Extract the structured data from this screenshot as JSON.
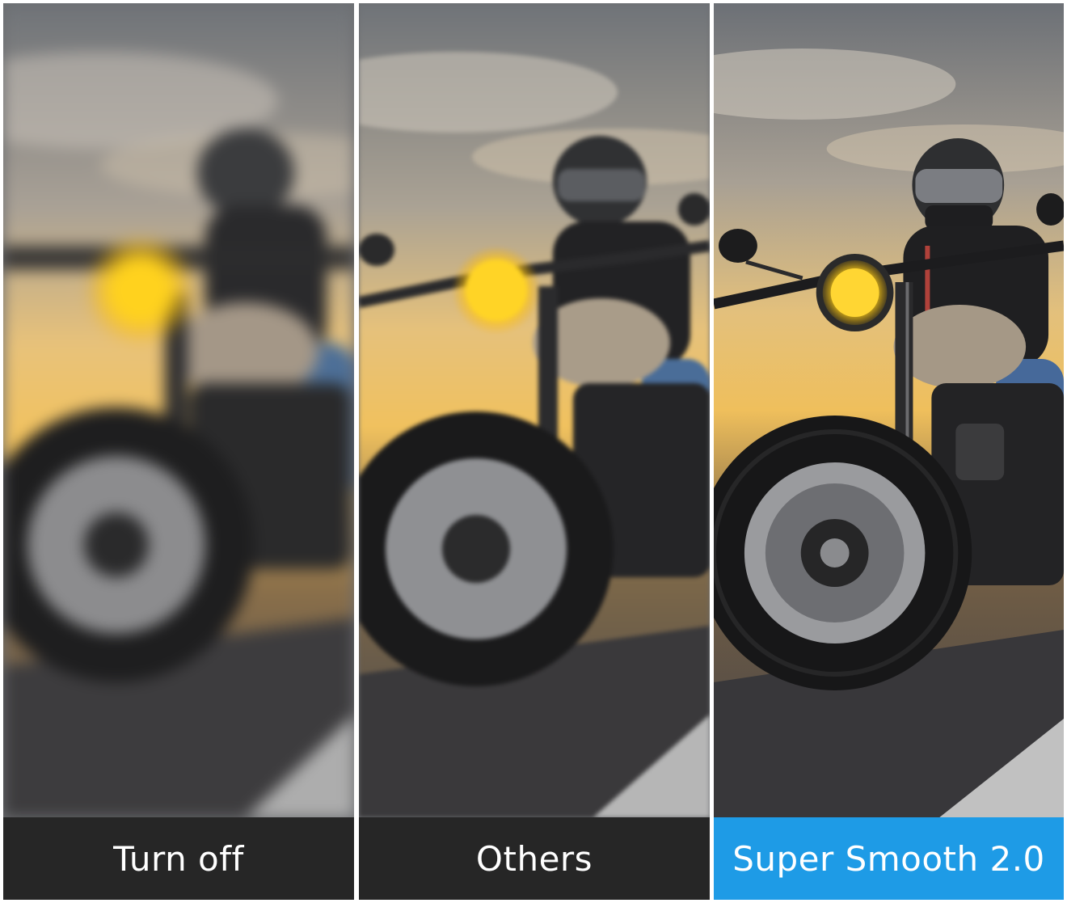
{
  "panels": [
    {
      "label": "Turn off",
      "blur": "heavy",
      "bar_color": "#262626"
    },
    {
      "label": "Others",
      "blur": "mid",
      "bar_color": "#262626"
    },
    {
      "label": "Super Smooth 2.0",
      "blur": "none",
      "bar_color": "#1e9be6"
    }
  ],
  "colors": {
    "accent": "#1e9be6",
    "dark_bar": "#262626",
    "headlight": "#ffd21e"
  }
}
